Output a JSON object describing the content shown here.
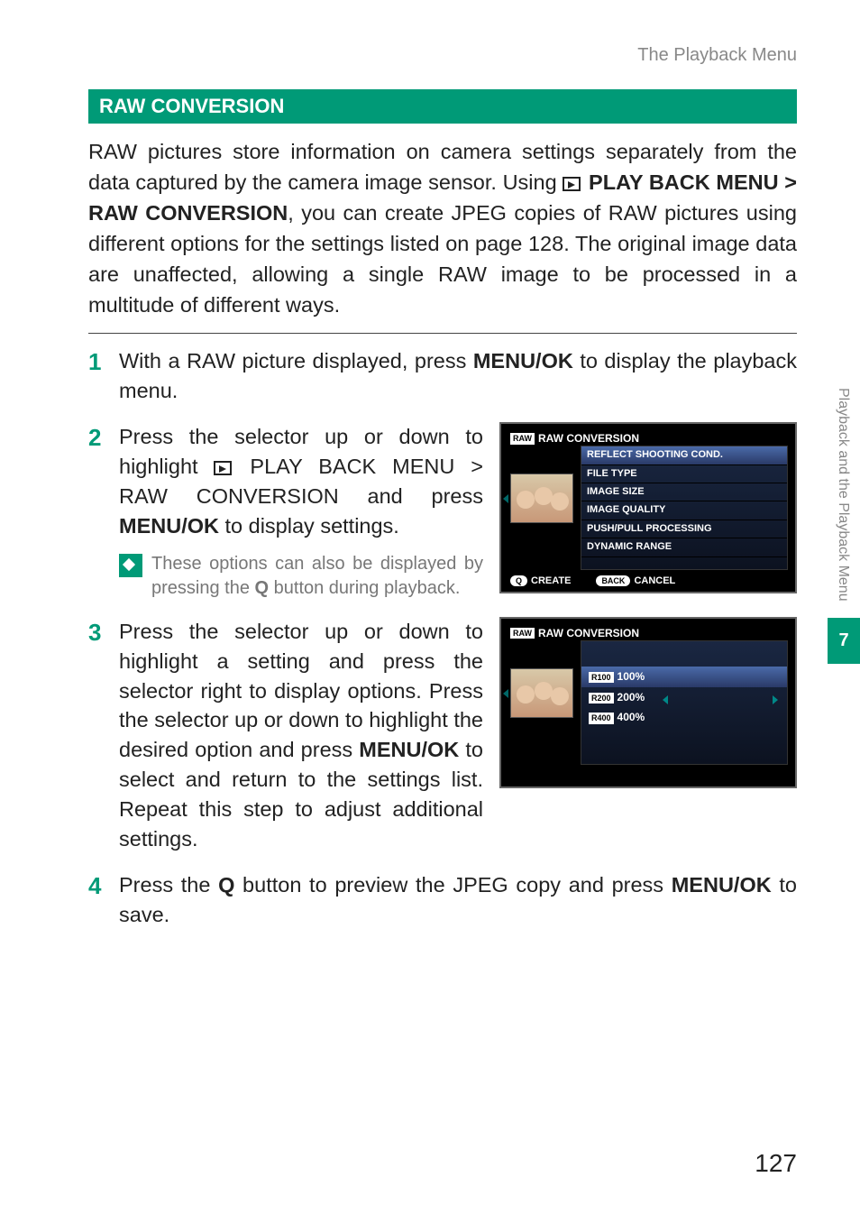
{
  "header": {
    "breadcrumb": "The Playback Menu"
  },
  "section": {
    "title": "RAW CONVERSION"
  },
  "intro": {
    "part1": "RAW pictures store information on camera settings separately from the data captured by the camera image sensor. Using ",
    "menu_path_1": "PLAY BACK MENU",
    "sep": " > ",
    "menu_path_2": "RAW CONVERSION",
    "part2": ", you can create JPEG copies of RAW pictures using different options for the settings listed on page 128. The original image data are unaffected, allowing a single RAW image to be processed in a multitude of different ways."
  },
  "steps": [
    {
      "num": "1",
      "text_a": "With a RAW picture displayed, press ",
      "btn1": "MENU/OK",
      "text_b": " to display the playback menu."
    },
    {
      "num": "2",
      "text_a": "Press the selector up or down to highlight ",
      "menu1": "PLAY BACK MENU",
      "sep": " > ",
      "menu2": "RAW CONVERSION",
      "text_b": " and press ",
      "btn1": "MENU/OK",
      "text_c": " to display settings.",
      "tip_a": "These options can also be displayed by pressing the ",
      "tip_btn": "Q",
      "tip_b": " button during playback."
    },
    {
      "num": "3",
      "text_a": "Press the selector up or down to highlight a setting and press the selector right to display options. Press the selector up or down to highlight the desired option and press ",
      "btn1": "MENU/OK",
      "text_b": " to select and return to the settings list. Repeat this step to adjust additional settings."
    },
    {
      "num": "4",
      "text_a": "Press the ",
      "btn1": "Q",
      "text_b": " button to preview the JPEG copy and press ",
      "btn2": "MENU/OK",
      "text_c": " to save."
    }
  ],
  "screen1": {
    "raw_badge": "RAW",
    "title": "RAW CONVERSION",
    "items": [
      "REFLECT SHOOTING COND.",
      "FILE TYPE",
      "IMAGE SIZE",
      "IMAGE QUALITY",
      "PUSH/PULL PROCESSING",
      "DYNAMIC RANGE"
    ],
    "footer_q": "Q",
    "footer_create": "CREATE",
    "footer_back": "BACK",
    "footer_cancel": "CANCEL"
  },
  "screen2": {
    "raw_badge": "RAW",
    "title": "RAW CONVERSION",
    "options": [
      {
        "badge": "R100",
        "label": "100%"
      },
      {
        "badge": "R200",
        "label": "200%"
      },
      {
        "badge": "R400",
        "label": "400%"
      }
    ]
  },
  "sidebar": {
    "label": "Playback and the Playback Menu",
    "chapter": "7"
  },
  "page_number": "127"
}
